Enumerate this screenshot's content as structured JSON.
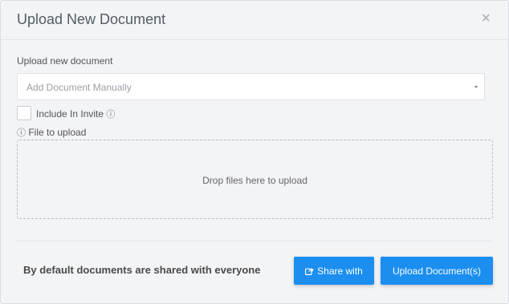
{
  "modal": {
    "title": "Upload New Document",
    "close_icon": "close-icon",
    "close_glyph": "×"
  },
  "form": {
    "document_label": "Upload new document",
    "document_select_value": "Add Document Manually",
    "include_in_invite_label": "Include In Invite",
    "include_in_invite_checked": false,
    "info_icon": "info-icon",
    "info_glyph": "ⓘ",
    "file_label": "File to upload",
    "dropzone_text": "Drop files here to upload"
  },
  "footer": {
    "note": "By default documents are shared with everyone",
    "share_button_label": "Share with",
    "share_icon": "share-icon",
    "upload_button_label": "Upload Document(s)"
  },
  "colors": {
    "primary_button": "#1b8ef0",
    "background": "#f3f4f6"
  }
}
